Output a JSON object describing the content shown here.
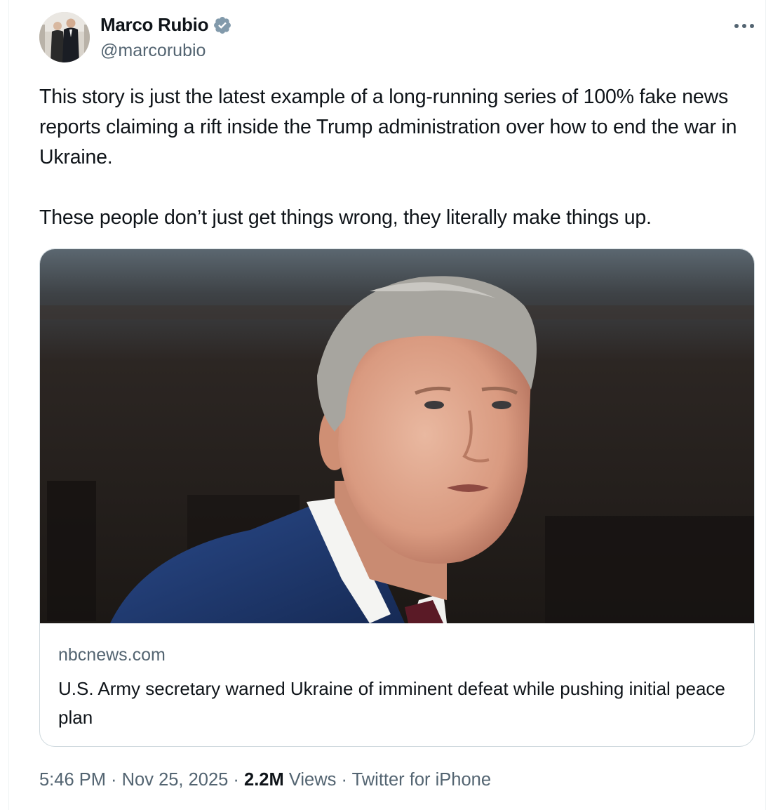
{
  "author": {
    "name": "Marco Rubio",
    "handle": "@marcorubio",
    "verified_icon": "verified-badge-icon"
  },
  "tweet": {
    "paragraph_1": "This story is just the latest example of a long-running series of  100% fake news reports claiming a rift inside the Trump administration over how to end the war in Ukraine.",
    "paragraph_2": "These people don’t just get things wrong, they literally make things up."
  },
  "link_card": {
    "domain": "nbcnews.com",
    "title": "U.S. Army secretary warned Ukraine of imminent defeat while pushing initial peace plan"
  },
  "meta": {
    "time": "5:46 PM",
    "separator": " · ",
    "date": "Nov 25, 2025",
    "views_count": "2.2M",
    "views_label": "Views",
    "source": "Twitter for iPhone"
  },
  "colors": {
    "text_primary": "#0f1419",
    "text_secondary": "#536471",
    "border": "#cfd9de",
    "verified": "#829aab"
  }
}
